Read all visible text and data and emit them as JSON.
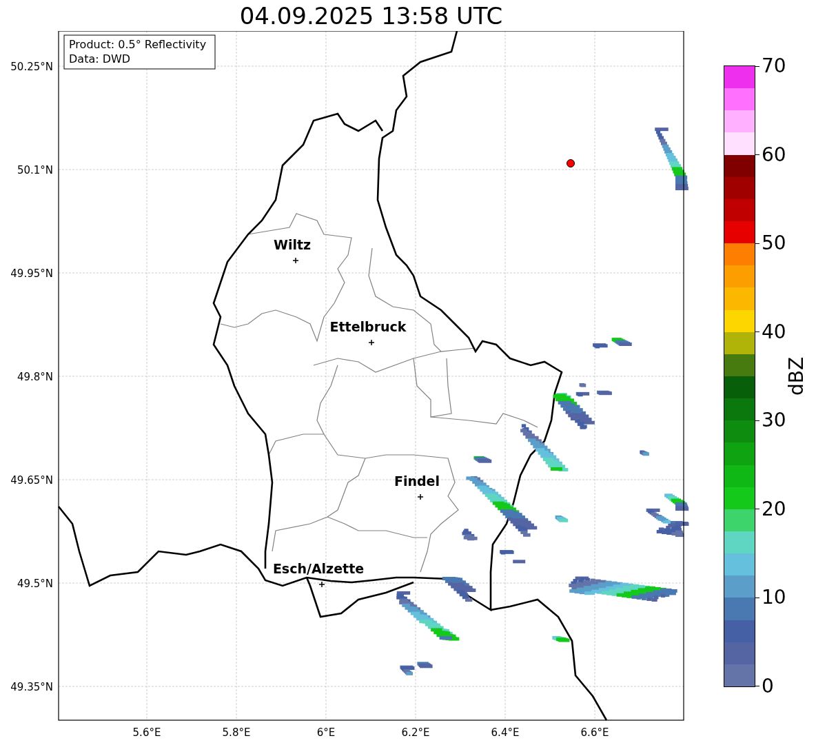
{
  "title": "04.09.2025 13:58 UTC",
  "info_box": {
    "lines": [
      "Product: 0.5° Reflectivity",
      "Data: DWD"
    ]
  },
  "y_ticks": [
    "50.25°N",
    "50.1°N",
    "49.95°N",
    "49.8°N",
    "49.65°N",
    "49.5°N",
    "49.35°N"
  ],
  "x_ticks": [
    "5.6°E",
    "5.8°E",
    "6°E",
    "6.2°E",
    "6.4°E",
    "6.6°E"
  ],
  "cities": [
    {
      "name": "Wiltz"
    },
    {
      "name": "Ettelbruck"
    },
    {
      "name": "Findel"
    },
    {
      "name": "Esch/Alzette"
    }
  ],
  "colorbar": {
    "label": "dBZ",
    "ticks": [
      "70",
      "60",
      "50",
      "40",
      "30",
      "20",
      "10",
      "0"
    ],
    "segments": [
      {
        "color": "#ee30ee"
      },
      {
        "color": "#ff70ff"
      },
      {
        "color": "#ffb0ff"
      },
      {
        "color": "#ffe0ff"
      },
      {
        "color": "#800000"
      },
      {
        "color": "#a00000"
      },
      {
        "color": "#c00000"
      },
      {
        "color": "#e60000"
      },
      {
        "color": "#fd7e00"
      },
      {
        "color": "#fd9e00"
      },
      {
        "color": "#fcb800"
      },
      {
        "color": "#fdd600"
      },
      {
        "color": "#b0b408"
      },
      {
        "color": "#477a0f"
      },
      {
        "color": "#085f0a"
      },
      {
        "color": "#0b780d"
      },
      {
        "color": "#0e8c10"
      },
      {
        "color": "#0fa312"
      },
      {
        "color": "#10b815"
      },
      {
        "color": "#14c91a"
      },
      {
        "color": "#3dd46b"
      },
      {
        "color": "#5fd6c2"
      },
      {
        "color": "#64c0dc"
      },
      {
        "color": "#5a9ec9"
      },
      {
        "color": "#4a78b0"
      },
      {
        "color": "#4560a5"
      },
      {
        "color": "#5565a3"
      },
      {
        "color": "#6574a8"
      }
    ]
  }
}
